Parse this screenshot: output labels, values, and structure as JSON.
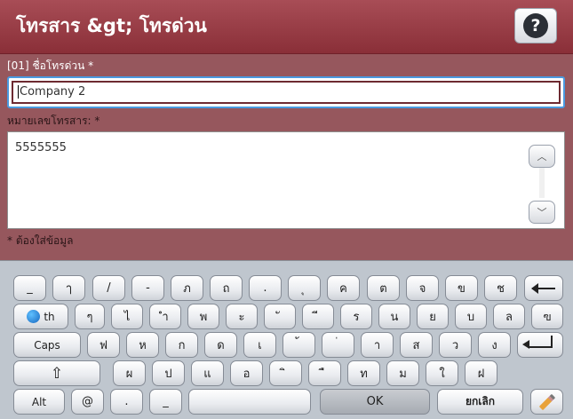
{
  "header": {
    "title": "โทรสาร &gt; โทรด่วน",
    "help_glyph": "?"
  },
  "form": {
    "name_label": "[01] ชื่อโทรด่วน *",
    "name_value": "Company 2",
    "number_label": "หมายเลขโทรสาร: *",
    "number_value": "5555555",
    "required_note": "* ต้องใส่ข้อมูล",
    "scroll_up_glyph": "︿",
    "scroll_down_glyph": "﹀"
  },
  "keyboard": {
    "row1": [
      "_",
      "ๅ",
      "/",
      "-",
      "ภ",
      "ถ",
      ".",
      "ุ",
      "ค",
      "ต",
      "จ",
      "ข",
      "ช"
    ],
    "row2": [
      "ๆ",
      "ไ",
      "ำ",
      "พ",
      "ะ",
      "ั",
      "ี",
      "ร",
      "น",
      "ย",
      "บ",
      "ล",
      "ฃ"
    ],
    "row3": [
      "ฟ",
      "ห",
      "ก",
      "ด",
      "เ",
      "้",
      "่",
      "า",
      "ส",
      "ว",
      "ง"
    ],
    "row4": [
      "ผ",
      "ป",
      "แ",
      "อ",
      "ิ",
      "ื",
      "ท",
      "ม",
      "ใ",
      "ฝ"
    ],
    "lang_label": "th",
    "caps_label": "Caps",
    "shift_glyph": "⇧",
    "alt_label": "Alt",
    "at_label": "@",
    "dot_label": ".",
    "underscore_label": "_",
    "ok_label": "OK",
    "cancel_label": "ยกเลิก"
  }
}
